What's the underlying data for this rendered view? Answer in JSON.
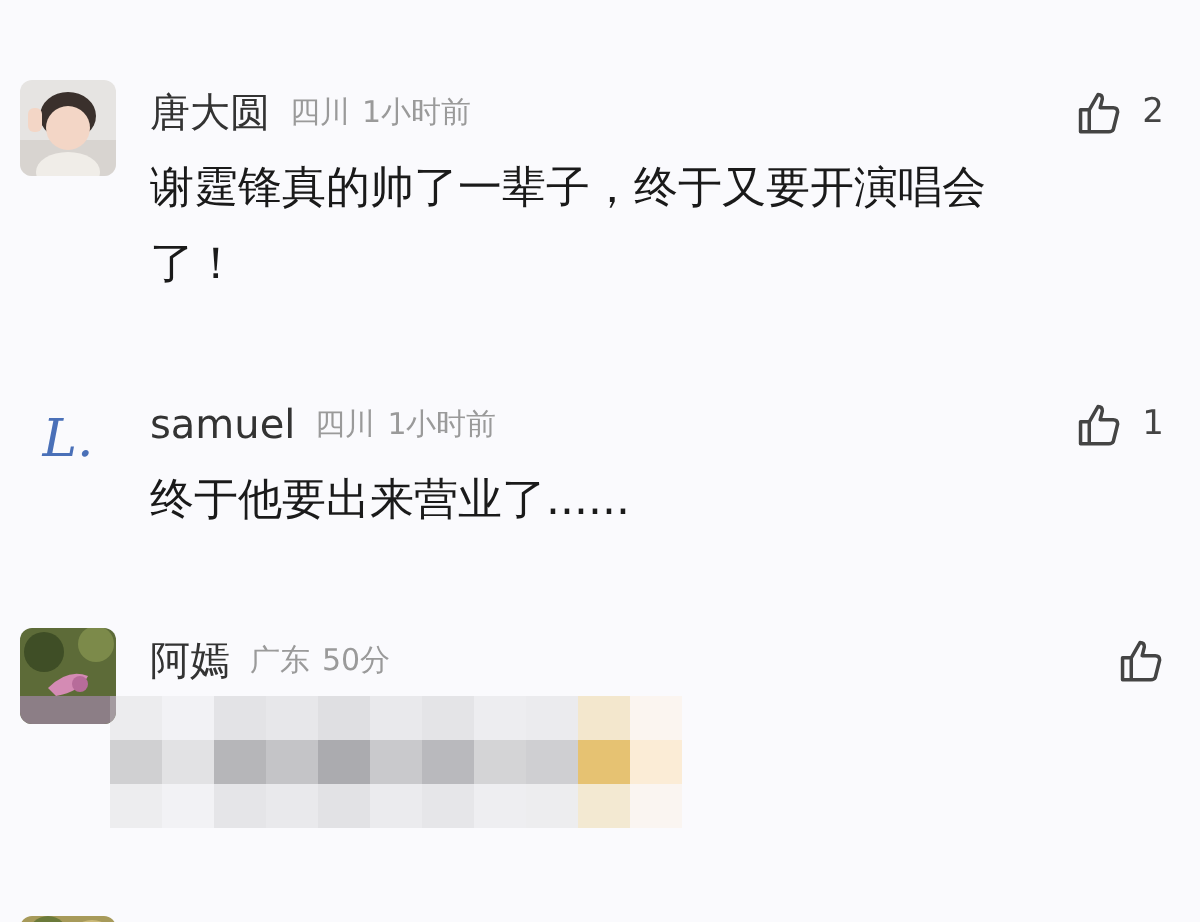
{
  "comments": [
    {
      "kind": "text",
      "name": "唐大圆",
      "region": "四川",
      "time": "1小时前",
      "text": "谢霆锋真的帅了一辈子，终于又要开演唱会了！",
      "likes": "2"
    },
    {
      "kind": "text",
      "avatar": {
        "kind": "letter",
        "text": "L."
      },
      "name": "samuel",
      "region": "四川",
      "time": "1小时前",
      "text": "终于他要出来营业了......",
      "likes": "1"
    },
    {
      "kind": "blurred",
      "name": "阿嫣",
      "region": "广东",
      "time": "50分"
    },
    {
      "kind": "cut"
    }
  ]
}
